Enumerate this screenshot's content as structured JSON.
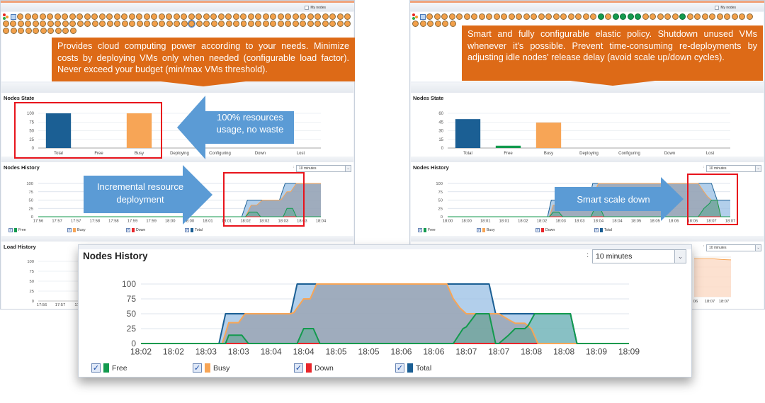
{
  "colors": {
    "free": "#139a4e",
    "busy": "#f7a556",
    "down": "#e8262b",
    "total": "#1b5f94",
    "callout": "#dd6a17",
    "blue_arrow": "#5b9bd5",
    "highlight": "#e8141c"
  },
  "left_panel": {
    "my_nodes_label": "My nodes",
    "nodes_grid": {
      "icons": [
        "resource-manager-icon",
        "host-icon"
      ],
      "rows": [
        {
          "count": 45,
          "free_indices": []
        },
        {
          "count": 47,
          "free_indices": [],
          "selected_index": 25
        },
        {
          "count": 10,
          "free_indices": []
        }
      ]
    },
    "callout_text": "Provides cloud computing power according to your needs. Minimize costs by deploying VMs only when needed (configurable load factor). Never exceed your budget (min/max VMs threshold).",
    "nodes_state_title": "Nodes State",
    "nodes_history_title": "Nodes History",
    "load_history_title": "Load History",
    "time_range": "10 minutes",
    "annotations": {
      "state_arrow": "100% resources usage, no waste",
      "history_arrow_line1": "Incremental resource",
      "history_arrow_line2": "deployment"
    },
    "legend": [
      {
        "label": "Free",
        "checked": true,
        "series": "free"
      },
      {
        "label": "Busy",
        "checked": true,
        "series": "busy"
      },
      {
        "label": "Down",
        "checked": true,
        "series": "down"
      },
      {
        "label": "Total",
        "checked": true,
        "series": "total"
      }
    ]
  },
  "right_panel": {
    "my_nodes_label": "My nodes",
    "nodes_grid": {
      "icons": [
        "resource-manager-icon",
        "host-icon"
      ],
      "rows": [
        {
          "count": 44,
          "free_indices": [
            23,
            25,
            26,
            27,
            28,
            34
          ]
        },
        {
          "count": 6,
          "free_indices": []
        }
      ]
    },
    "callout_text": "Smart and fully configurable elastic policy. Shutdown unused VMs whenever it's possible. Prevent time-consuming re-deployments by adjusting idle nodes' release delay (avoid scale up/down cycles).",
    "nodes_state_title": "Nodes State",
    "nodes_history_title": "Nodes History",
    "time_range": "10 minutes",
    "load_time_range": "10 minutes",
    "annotations": {
      "history_arrow": "Smart scale down"
    },
    "legend": [
      {
        "label": "Free",
        "checked": true,
        "series": "free"
      },
      {
        "label": "Busy",
        "checked": true,
        "series": "busy"
      },
      {
        "label": "Down",
        "checked": true,
        "series": "down"
      },
      {
        "label": "Total",
        "checked": true,
        "series": "total"
      }
    ]
  },
  "popup": {
    "title": "Nodes History",
    "time_range": "10 minutes",
    "legend": [
      {
        "label": "Free",
        "checked": true,
        "series": "free"
      },
      {
        "label": "Busy",
        "checked": true,
        "series": "busy"
      },
      {
        "label": "Down",
        "checked": true,
        "series": "down"
      },
      {
        "label": "Total",
        "checked": true,
        "series": "total"
      }
    ]
  },
  "chart_data": [
    {
      "id": "left-state",
      "type": "bar",
      "title": "Nodes State",
      "categories": [
        "Total",
        "Free",
        "Busy",
        "Deploying",
        "Configuring",
        "Down",
        "Lost"
      ],
      "values": [
        100,
        0,
        100,
        0,
        0,
        0,
        0
      ],
      "colors": [
        "#1b5f94",
        "#139a4e",
        "#f7a556",
        "#999999",
        "#999999",
        "#e8262b",
        "#999999"
      ],
      "yticks": [
        0,
        25,
        50,
        75,
        100
      ],
      "ylim": [
        0,
        100
      ],
      "grid": true
    },
    {
      "id": "right-state",
      "type": "bar",
      "title": "Nodes State",
      "categories": [
        "Total",
        "Free",
        "Busy",
        "Deploying",
        "Configuring",
        "Down",
        "Lost"
      ],
      "values": [
        50,
        4,
        44,
        0,
        0,
        0,
        0
      ],
      "colors": [
        "#1b5f94",
        "#139a4e",
        "#f7a556",
        "#999999",
        "#999999",
        "#e8262b",
        "#999999"
      ],
      "yticks": [
        0,
        15,
        30,
        45,
        60
      ],
      "ylim": [
        0,
        60
      ],
      "grid": true
    },
    {
      "id": "left-history",
      "type": "area",
      "title": "Nodes History",
      "xticks": [
        "17:56",
        "17:57",
        "17:57",
        "17:58",
        "17:58",
        "17:59",
        "17:59",
        "18:00",
        "18:00",
        "18:01",
        "18:01",
        "18:02",
        "18:02",
        "18:03",
        "18:03",
        "18:04"
      ],
      "xrange": [
        0,
        15
      ],
      "yticks": [
        0,
        25,
        50,
        75,
        100
      ],
      "ylim": [
        0,
        100
      ],
      "grid": true,
      "legend": "bottom",
      "series": [
        {
          "name": "Total",
          "points": [
            [
              0,
              0
            ],
            [
              10.8,
              0
            ],
            [
              11.1,
              50
            ],
            [
              12.8,
              50
            ],
            [
              13.1,
              100
            ],
            [
              15,
              100
            ]
          ]
        },
        {
          "name": "Busy",
          "points": [
            [
              0,
              0
            ],
            [
              11.0,
              0
            ],
            [
              11.3,
              35
            ],
            [
              11.6,
              35
            ],
            [
              11.9,
              50
            ],
            [
              12.8,
              50
            ],
            [
              12.9,
              52
            ],
            [
              13.2,
              75
            ],
            [
              13.4,
              75
            ],
            [
              13.7,
              100
            ],
            [
              15,
              100
            ]
          ]
        },
        {
          "name": "Free",
          "points": [
            [
              0,
              0
            ],
            [
              11.0,
              0
            ],
            [
              11.2,
              14
            ],
            [
              11.6,
              14
            ],
            [
              11.8,
              0
            ],
            [
              13.0,
              0
            ],
            [
              13.2,
              25
            ],
            [
              13.5,
              25
            ],
            [
              13.7,
              0
            ],
            [
              15,
              0
            ]
          ]
        },
        {
          "name": "Down",
          "points": [
            [
              0,
              0
            ],
            [
              15,
              0
            ]
          ]
        }
      ]
    },
    {
      "id": "right-history",
      "type": "area",
      "title": "Nodes History",
      "xticks": [
        "18:00",
        "18:00",
        "18:01",
        "18:01",
        "18:02",
        "18:02",
        "18:03",
        "18:03",
        "18:04",
        "18:04",
        "18:05",
        "18:05",
        "18:06",
        "18:06",
        "18:07",
        "18:07"
      ],
      "xrange": [
        0,
        15
      ],
      "yticks": [
        0,
        25,
        50,
        75,
        100
      ],
      "ylim": [
        0,
        100
      ],
      "grid": true,
      "legend": "bottom",
      "series": [
        {
          "name": "Total",
          "points": [
            [
              0,
              0
            ],
            [
              5.3,
              0
            ],
            [
              5.5,
              50
            ],
            [
              7.5,
              50
            ],
            [
              7.7,
              100
            ],
            [
              14.0,
              100
            ],
            [
              14.3,
              50
            ],
            [
              15,
              50
            ]
          ]
        },
        {
          "name": "Busy",
          "points": [
            [
              0,
              0
            ],
            [
              5.4,
              0
            ],
            [
              5.6,
              35
            ],
            [
              5.9,
              35
            ],
            [
              6.1,
              50
            ],
            [
              7.5,
              50
            ],
            [
              7.8,
              75
            ],
            [
              8.0,
              100
            ],
            [
              13.3,
              100
            ],
            [
              13.6,
              75
            ],
            [
              13.8,
              60
            ],
            [
              14.0,
              50
            ],
            [
              14.3,
              50
            ],
            [
              14.5,
              0
            ],
            [
              15,
              0
            ]
          ]
        },
        {
          "name": "Free",
          "points": [
            [
              0,
              0
            ],
            [
              5.4,
              0
            ],
            [
              5.6,
              14
            ],
            [
              5.9,
              14
            ],
            [
              6.1,
              0
            ],
            [
              7.6,
              0
            ],
            [
              7.8,
              25
            ],
            [
              8.1,
              25
            ],
            [
              8.3,
              0
            ],
            [
              13.3,
              0
            ],
            [
              13.6,
              25
            ],
            [
              13.9,
              40
            ],
            [
              14.0,
              50
            ],
            [
              14.3,
              50
            ],
            [
              14.5,
              0
            ],
            [
              15,
              0
            ]
          ]
        },
        {
          "name": "Down",
          "points": [
            [
              0,
              0
            ],
            [
              15,
              0
            ]
          ]
        }
      ]
    },
    {
      "id": "popup-history",
      "type": "area",
      "title": "Nodes History",
      "xticks": [
        "18:02",
        "18:02",
        "18:03",
        "18:03",
        "18:04",
        "18:04",
        "18:05",
        "18:05",
        "18:06",
        "18:06",
        "18:07",
        "18:07",
        "18:08",
        "18:08",
        "18:09",
        "18:09"
      ],
      "xrange": [
        0,
        15
      ],
      "yticks": [
        0,
        25,
        50,
        75,
        100
      ],
      "ylim": [
        0,
        100
      ],
      "grid": true,
      "legend": "bottom",
      "series": [
        {
          "name": "Total",
          "points": [
            [
              0,
              0
            ],
            [
              2.4,
              0
            ],
            [
              2.6,
              50
            ],
            [
              4.6,
              50
            ],
            [
              4.8,
              100
            ],
            [
              10.7,
              100
            ],
            [
              10.9,
              50
            ],
            [
              13.2,
              50
            ],
            [
              13.4,
              0
            ],
            [
              15,
              0
            ]
          ]
        },
        {
          "name": "Busy",
          "points": [
            [
              0,
              0
            ],
            [
              2.5,
              0
            ],
            [
              2.7,
              35
            ],
            [
              3.0,
              35
            ],
            [
              3.2,
              50
            ],
            [
              4.6,
              50
            ],
            [
              4.7,
              52
            ],
            [
              5.0,
              75
            ],
            [
              5.2,
              75
            ],
            [
              5.4,
              100
            ],
            [
              9.4,
              100
            ],
            [
              9.6,
              75
            ],
            [
              9.8,
              60
            ],
            [
              10.0,
              50
            ],
            [
              11.0,
              50
            ],
            [
              11.3,
              40
            ],
            [
              11.5,
              34
            ],
            [
              11.8,
              34
            ],
            [
              12.0,
              25
            ],
            [
              12.2,
              0
            ],
            [
              15,
              0
            ]
          ]
        },
        {
          "name": "Free",
          "points": [
            [
              0,
              0
            ],
            [
              2.6,
              0
            ],
            [
              2.7,
              14
            ],
            [
              3.1,
              14
            ],
            [
              3.3,
              0
            ],
            [
              4.8,
              0
            ],
            [
              5.0,
              25
            ],
            [
              5.3,
              25
            ],
            [
              5.5,
              0
            ],
            [
              9.6,
              0
            ],
            [
              9.9,
              25
            ],
            [
              10.0,
              28
            ],
            [
              10.3,
              50
            ],
            [
              10.7,
              50
            ],
            [
              10.9,
              0
            ],
            [
              11.0,
              0
            ],
            [
              11.3,
              14
            ],
            [
              11.5,
              25
            ],
            [
              11.8,
              25
            ],
            [
              11.9,
              30
            ],
            [
              12.1,
              50
            ],
            [
              13.2,
              50
            ],
            [
              13.4,
              0
            ],
            [
              15,
              0
            ]
          ]
        },
        {
          "name": "Down",
          "points": [
            [
              0,
              0
            ],
            [
              15,
              0
            ]
          ]
        }
      ]
    },
    {
      "id": "left-load",
      "type": "line",
      "title": "Load History",
      "xticks": [
        "17:56",
        "17:57",
        "17:5"
      ],
      "yticks": [
        0,
        25,
        50,
        75,
        100
      ],
      "ylim": [
        0,
        100
      ],
      "grid": true,
      "series": []
    },
    {
      "id": "right-load",
      "type": "area",
      "title": "Load History",
      "xticks": [
        "06",
        "18:07",
        "18:07"
      ],
      "ylim": [
        0,
        100
      ],
      "grid": true,
      "series": [
        {
          "name": "Load",
          "points": [
            [
              0,
              96
            ],
            [
              1,
              96
            ],
            [
              1.5,
              94
            ],
            [
              2,
              93
            ]
          ]
        }
      ]
    }
  ]
}
